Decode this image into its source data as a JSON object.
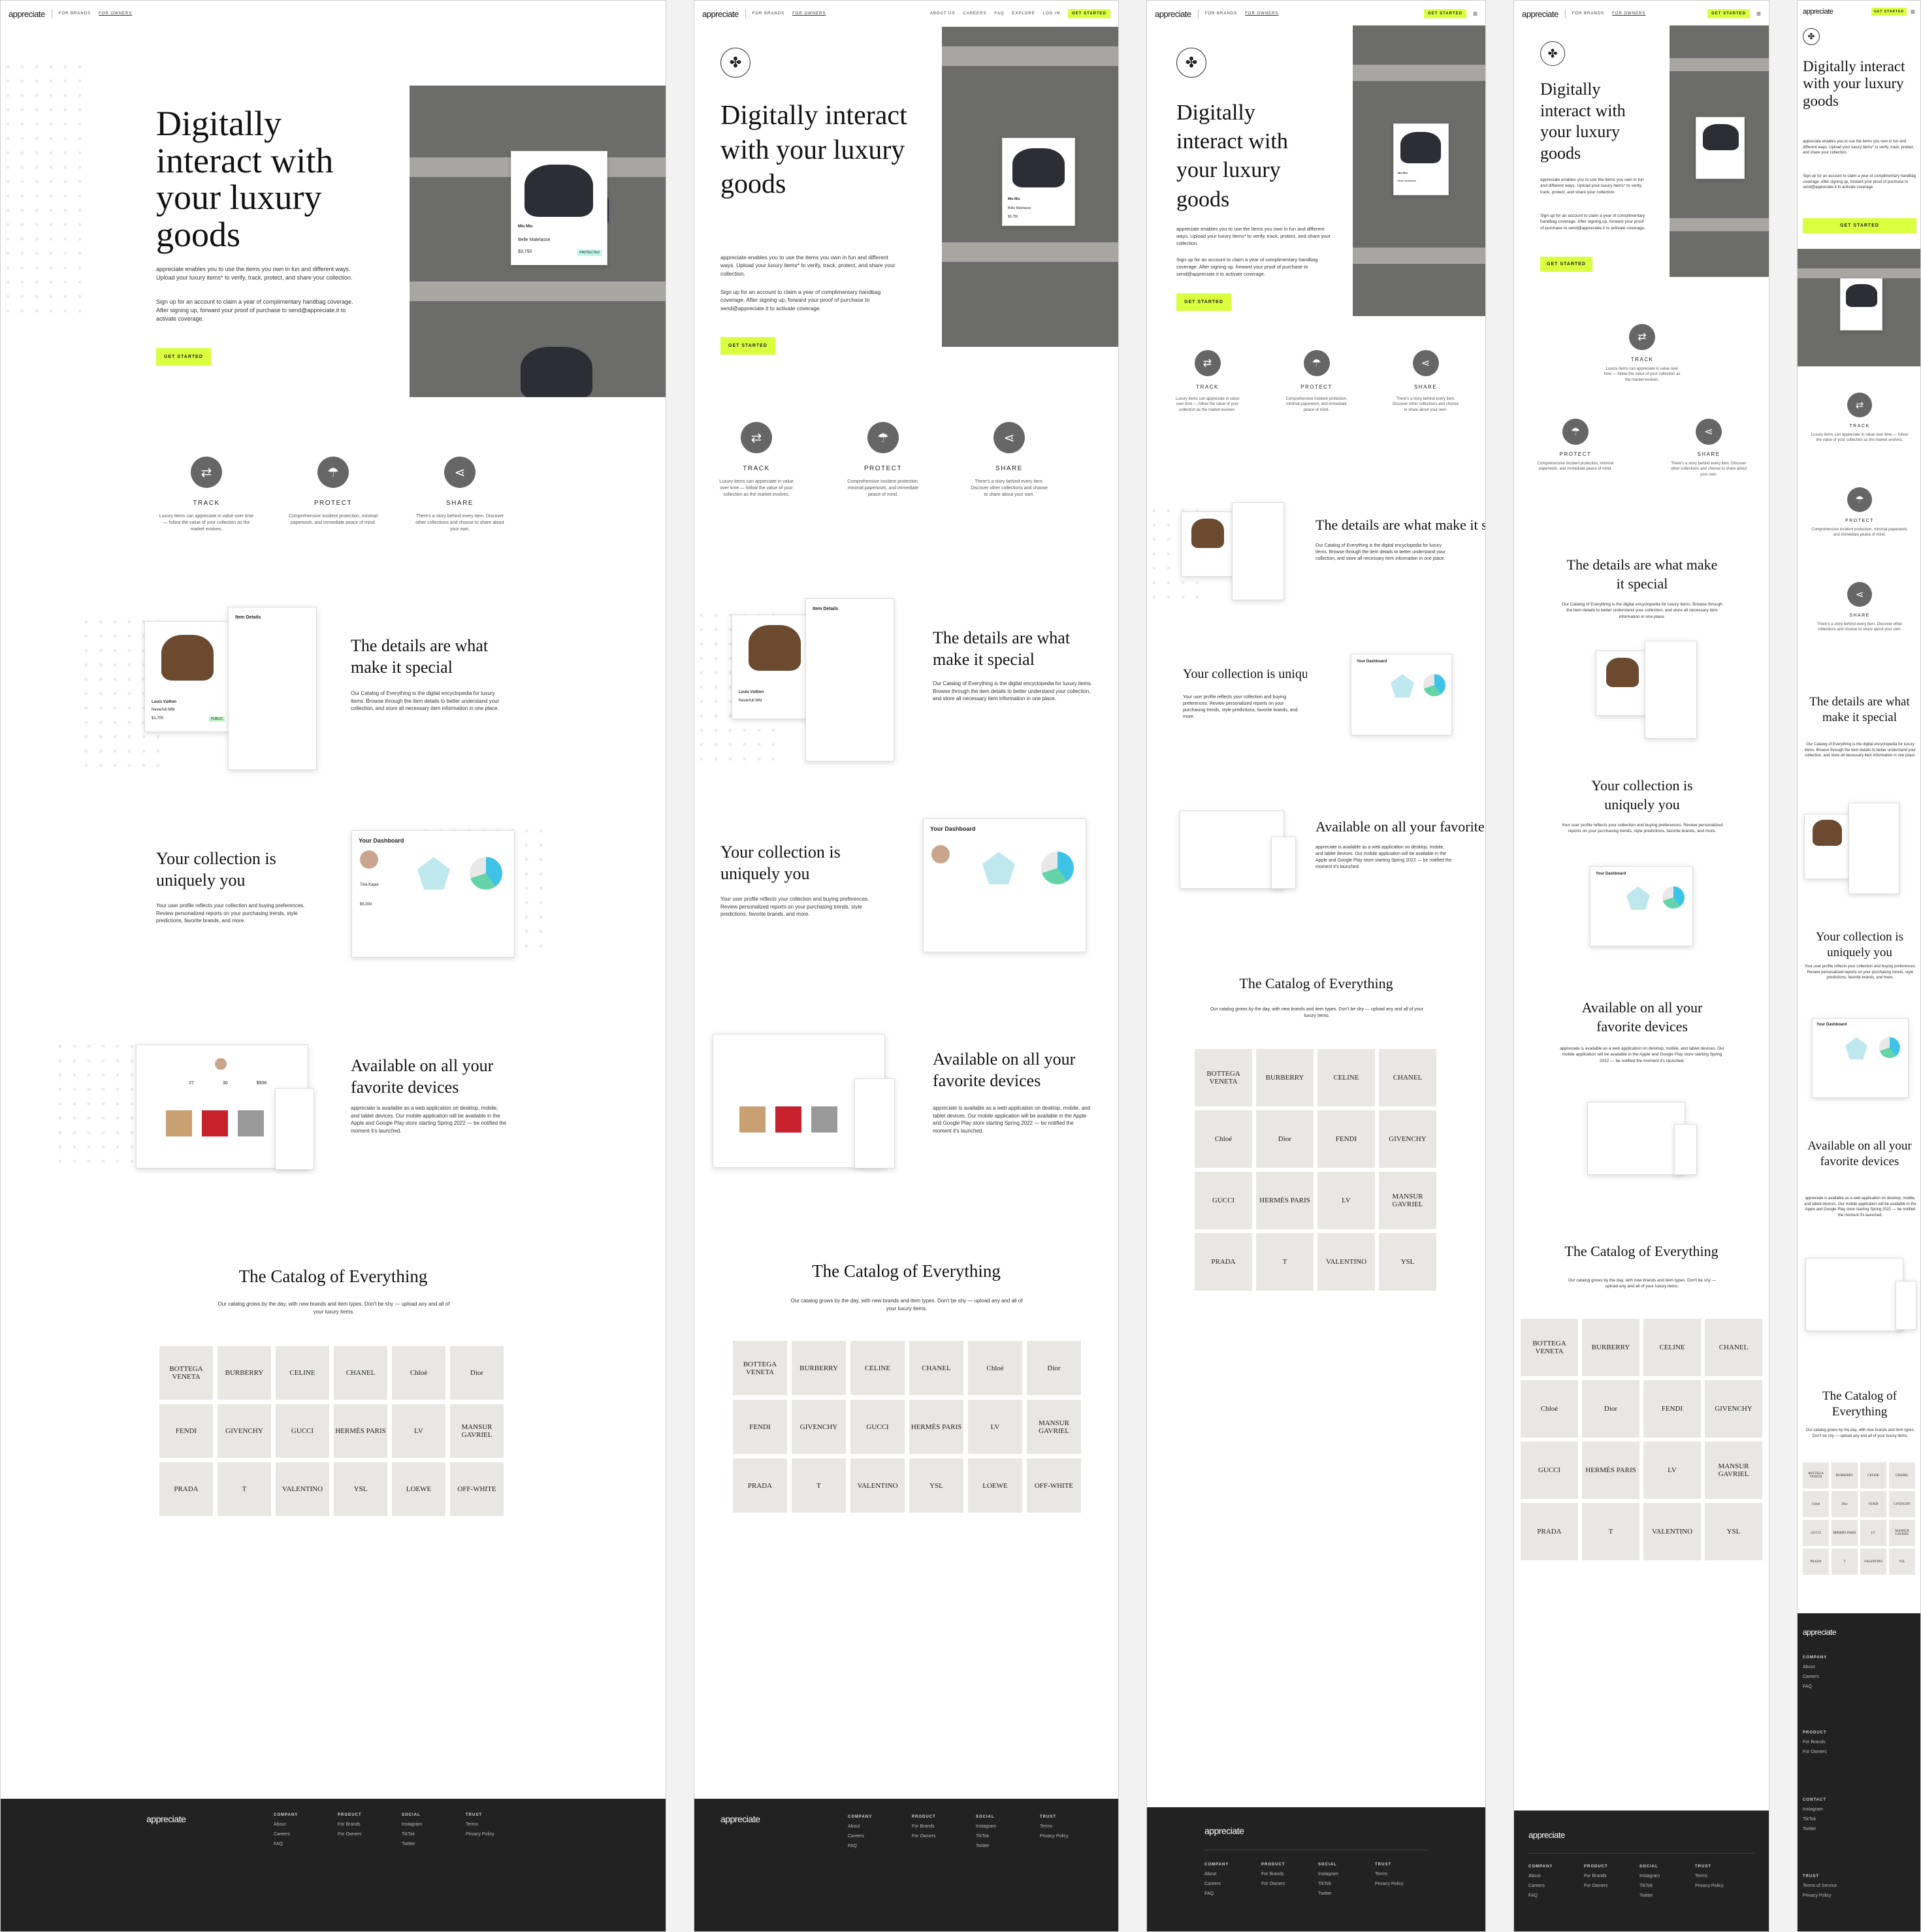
{
  "brand": {
    "logo": "appreciate",
    "accent": "#d9ff3f",
    "footer_bg": "#222222"
  },
  "nav": {
    "for_brands": "FOR BRANDS",
    "for_owners": "FOR OWNERS",
    "about": "ABOUT US",
    "careers": "CAREERS",
    "faq": "FAQ",
    "explore": "EXPLORE",
    "login": "LOG IN",
    "get_started": "GET STARTED",
    "menu_icon": "hamburger-icon"
  },
  "hero": {
    "title": "Digitally interact with your luxury goods",
    "p1": "appreciate enables you to use the items you own in fun and different ways. Upload your luxury items* to verify, track, protect, and share your collection.",
    "p2": "Sign up for an account to claim a year of complimentary handbag coverage. After signing up, forward your proof of purchase to send@appreciate.it to activate coverage.",
    "cta": "GET STARTED",
    "card": {
      "brand": "Miu Miu",
      "name": "Belle Matelasse",
      "price": "$3,750",
      "badge": "PROTECTED"
    }
  },
  "features": [
    {
      "title": "TRACK",
      "desc": "Luxury items can appreciate in value over time — follow the value of your collection as the market evolves.",
      "icon": "arrows-icon"
    },
    {
      "title": "PROTECT",
      "desc": "Comprehensive incident protection, minimal paperwork, and immediate peace of mind.",
      "icon": "umbrella-icon"
    },
    {
      "title": "SHARE",
      "desc": "There's a story behind every item. Discover other collections and choose to share about your own.",
      "icon": "share-icon"
    }
  ],
  "details": {
    "title": "The details are what make it special",
    "body": "Our Catalog of Everything is the digital encyclopedia for luxury items. Browse through the item details to better understand your collection, and store all necessary item information in one place.",
    "card": {
      "header": "Item Details",
      "brand": "Louis Vuitton",
      "model": "Neverfull MM",
      "price": "$1,700",
      "badge": "PUBLIC"
    }
  },
  "collection": {
    "title": "Your collection is uniquely you",
    "body": "Your user profile reflects your collection and buying preferences. Review personalized reports on your purchasing trends, style predictions, favorite brands, and more.",
    "card": {
      "header": "Your Dashboard",
      "name": "Tina Kapor",
      "location": "Location",
      "value": "$5,000",
      "since": "September 2021"
    }
  },
  "devices": {
    "title": "Available on all your favorite devices",
    "body": "appreciate is available as a web application on desktop, mobile, and tablet devices. Our mobile application will be available in the Apple and Google Play store starting Spring 2022 — be notified the moment it's launched.",
    "stats": [
      "27",
      "30",
      "$50K"
    ]
  },
  "catalog": {
    "title": "The Catalog of Everything",
    "body": "Our catalog grows by the day, with new brands and item types. Don't be shy — upload any and all of your luxury items.",
    "brands": [
      "BOTTEGA VENETA",
      "BURBERRY",
      "CELINE",
      "CHANEL",
      "Chloé",
      "Dior",
      "FENDI",
      "GIVENCHY",
      "GUCCI",
      "HERMÈS PARIS",
      "LV",
      "MANSUR GAVRIEL",
      "PRADA",
      "T",
      "VALENTINO",
      "YSL",
      "LOEWE",
      "OFF-WHITE"
    ]
  },
  "footer": {
    "logo": "appreciate",
    "company": {
      "heading": "COMPANY",
      "items": [
        "About",
        "Careers",
        "FAQ"
      ]
    },
    "product": {
      "heading": "PRODUCT",
      "items": [
        "For Brands",
        "For Owners"
      ]
    },
    "social": {
      "heading": "SOCIAL",
      "items": [
        "Instagram",
        "TikTok",
        "Twitter"
      ]
    },
    "trust": {
      "heading": "TRUST",
      "items": [
        "Terms",
        "Privacy Policy"
      ]
    },
    "trust_mobile": {
      "items": [
        "Terms of Service",
        "Privacy Policy"
      ]
    },
    "contact": {
      "heading": "CONTACT"
    }
  }
}
